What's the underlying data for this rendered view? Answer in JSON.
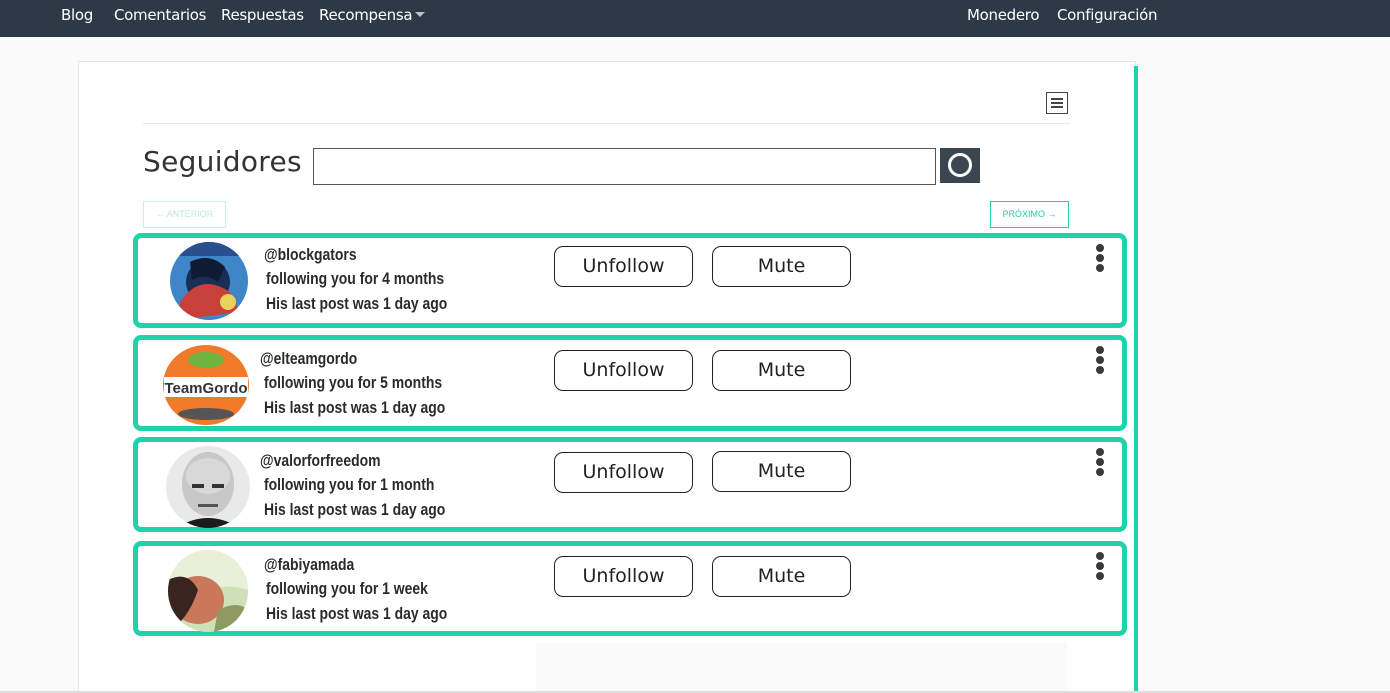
{
  "nav": {
    "left": [
      "Blog",
      "Comentarios",
      "Respuestas",
      "Recompensa"
    ],
    "right": [
      "Monedero",
      "Configuración"
    ]
  },
  "page": {
    "title": "Seguidores",
    "search_value": "",
    "search_icon": "search-ring-icon",
    "prev_label": "← ANTERIOR",
    "next_label": "PRÓXIMO →",
    "menu_icon": "menu-toggle-icon"
  },
  "colors": {
    "navbar": "#2c3a47",
    "accent": "#1dd3a7",
    "search_button": "#3b4650"
  },
  "followers": [
    {
      "handle": "@blockgators",
      "duration": "following you for 4 months",
      "last_post": "His last post was 1 day ago",
      "unfollow_label": "Unfollow",
      "mute_label": "Mute",
      "avatar_icon": "comic-avatar"
    },
    {
      "handle": "@elteamgordo",
      "duration": "following you for 5 months",
      "last_post": "His last post was 1 day ago",
      "unfollow_label": "Unfollow",
      "mute_label": "Mute",
      "avatar_icon": "team-gordo-logo-avatar"
    },
    {
      "handle": "@valorforfreedom",
      "duration": "following you for 1 month",
      "last_post": "His last post was 1 day ago",
      "unfollow_label": "Unfollow",
      "mute_label": "Mute",
      "avatar_icon": "portrait-avatar"
    },
    {
      "handle": "@fabiyamada",
      "duration": "following you for 1 week",
      "last_post": "His last post was 1 day ago",
      "unfollow_label": "Unfollow",
      "mute_label": "Mute",
      "avatar_icon": "photo-avatar"
    }
  ]
}
